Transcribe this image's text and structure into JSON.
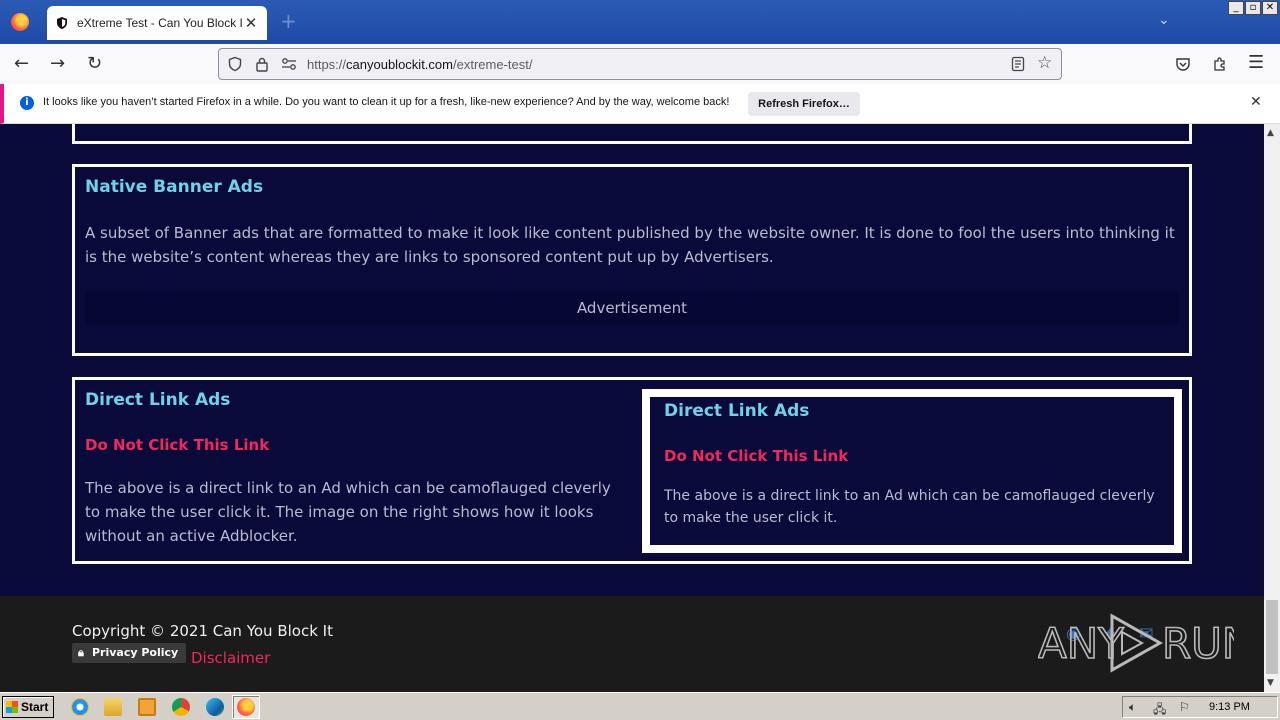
{
  "browser": {
    "tab_title": "eXtreme Test - Can You Block It ?",
    "tab_close": "✕",
    "new_tab": "+",
    "window_controls": [
      "_",
      "▫",
      "✕"
    ],
    "url_scheme": "https://",
    "url_host": "canyoublockit.com",
    "url_path": "/extreme-test/",
    "notification": {
      "text": "It looks like you haven’t started Firefox in a while. Do you want to clean it up for a fresh, like-new experience? And by the way, welcome back!",
      "button_label": "Refresh Firefox…",
      "close": "✕"
    }
  },
  "page": {
    "native": {
      "heading": "Native Banner Ads",
      "body": "A subset of Banner ads that are formatted to make it look like content published by the website owner. It is done to fool the users into thinking it is the website’s content whereas they are links to sponsored content put up by Advertisers.",
      "ad_label": "Advertisement"
    },
    "direct": {
      "heading": "Direct Link Ads",
      "link_text": "Do Not Click This Link",
      "body": "The above is a direct link to an Ad which can be camoflauged cleverly to make the user click it. The image on the right shows how it looks without an active Adblocker.",
      "preview": {
        "heading": "Direct Link Ads",
        "link_text": "Do Not Click This Link",
        "body": "The above is a direct link to an Ad which can be camoflauged cleverly to make the user click it."
      }
    },
    "footer": {
      "copyright": "Copyright © 2021 Can You Block It",
      "privacy_label": "Privacy Policy",
      "disclaimer": "Disclaimer"
    }
  },
  "watermark": {
    "left": "ANY",
    "right": "RUN"
  },
  "taskbar": {
    "start_label": "Start",
    "clock": "9:13 PM"
  },
  "colors": {
    "page_bg": "#0a0a3a",
    "heading_cyan": "#6fd3e8",
    "link_red": "#f2275a",
    "footer_bg": "#1b1b1b"
  }
}
